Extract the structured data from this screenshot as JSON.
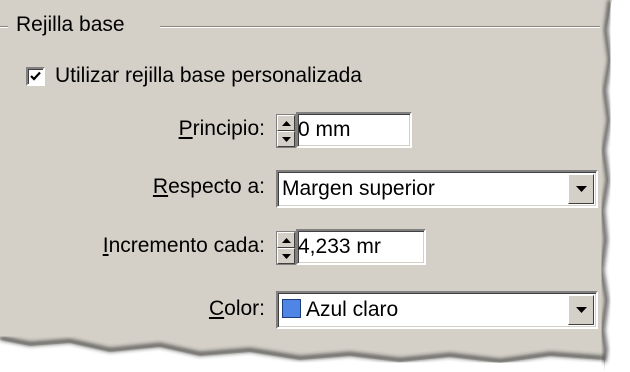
{
  "group": {
    "title": "Rejilla base"
  },
  "custom_grid": {
    "label": "Utilizar rejilla base personalizada",
    "checked": true
  },
  "start": {
    "label_mnemonic": "P",
    "label_rest": "rincipio:",
    "value": "0 mm"
  },
  "relative_to": {
    "label_mnemonic": "R",
    "label_rest": "especto a:",
    "value": "Margen superior"
  },
  "increment": {
    "label_mnemonic": "I",
    "label_rest": "ncremento cada:",
    "value": "4,233 mr"
  },
  "color": {
    "label_mnemonic": "C",
    "label_rest": "olor:",
    "value": "Azul claro",
    "swatch": "#4f86e6"
  },
  "icons": {
    "spinner": "spin-up-down-icon",
    "dropdown": "chevron-down-icon",
    "check": "checkmark-icon"
  }
}
